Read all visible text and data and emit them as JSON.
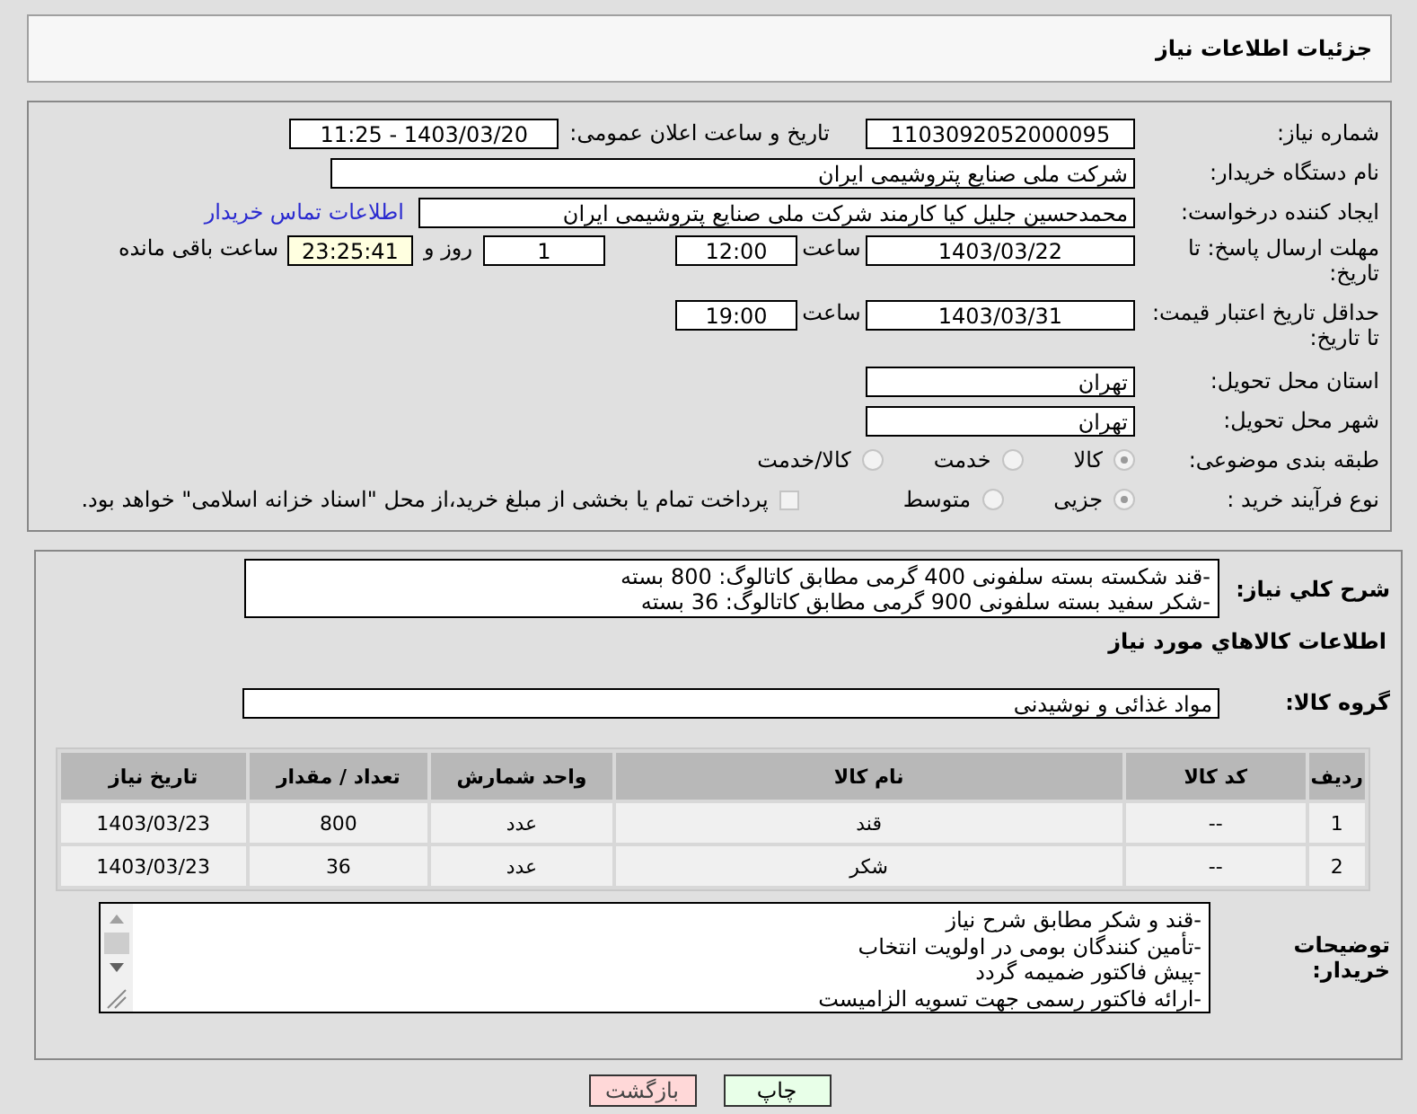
{
  "header": {
    "title": "جزئیات اطلاعات نیاز"
  },
  "need_number": {
    "label": "شماره نیاز:",
    "value": "1103092052000095"
  },
  "announce": {
    "label": "تاریخ و ساعت اعلان عمومی:",
    "value": "1403/03/20 - 11:25"
  },
  "buyer": {
    "label": "نام دستگاه خریدار:",
    "value": "شرکت ملی صنایع پتروشیمی ایران"
  },
  "requester": {
    "label": "ایجاد کننده درخواست:",
    "value": "محمدحسین جلیل کیا کارمند شرکت ملی صنایع پتروشیمی ایران",
    "link": "اطلاعات تماس خریدار"
  },
  "deadline": {
    "label": "مهلت ارسال پاسخ: تا تاریخ:",
    "date": "1403/03/22",
    "time_label": "ساعت",
    "time": "12:00",
    "days": "1",
    "days_label": "روز و",
    "remaining": "23:25:41",
    "remaining_label": "ساعت باقی مانده"
  },
  "validity": {
    "label": "حداقل تاریخ اعتبار قیمت: تا تاریخ:",
    "date": "1403/03/31",
    "time_label": "ساعت",
    "time": "19:00"
  },
  "province": {
    "label": "استان محل تحویل:",
    "value": "تهران"
  },
  "city": {
    "label": "شهر محل تحویل:",
    "value": "تهران"
  },
  "category": {
    "label": "طبقه بندی موضوعی:",
    "options": [
      {
        "label": "کالا",
        "selected": true
      },
      {
        "label": "خدمت",
        "selected": false
      },
      {
        "label": "کالا/خدمت",
        "selected": false
      }
    ]
  },
  "process": {
    "label": "نوع فرآیند خرید :",
    "options": [
      {
        "label": "جزیی",
        "selected": true
      },
      {
        "label": "متوسط",
        "selected": false
      }
    ],
    "treasury": {
      "checked": false,
      "label": "پرداخت تمام یا بخشی از مبلغ خرید،از محل \"اسناد خزانه اسلامی\" خواهد بود."
    }
  },
  "description": {
    "label": "شرح کلي نیاز:",
    "lines": [
      "-قند شکسته بسته سلفونی 400 گرمی مطابق کاتالوگ: 800 بسته",
      "-شکر سفید بسته سلفونی 900 گرمی مطابق کاتالوگ: 36 بسته"
    ]
  },
  "items_heading": "اطلاعات کالاهاي مورد نیاز",
  "goods_group": {
    "label": "گروه کالا:",
    "value": "مواد غذائی و نوشیدنی"
  },
  "table": {
    "columns": [
      "ردیف",
      "کد کالا",
      "نام کالا",
      "واحد شمارش",
      "تعداد / مقدار",
      "تاریخ نیاز"
    ],
    "rows": [
      [
        "1",
        "--",
        "قند",
        "عدد",
        "800",
        "1403/03/23"
      ],
      [
        "2",
        "--",
        "شکر",
        "عدد",
        "36",
        "1403/03/23"
      ]
    ]
  },
  "notes": {
    "label": "توضیحات خریدار:",
    "lines": [
      "-قند و شکر مطابق شرح نیاز",
      "-تأمین کنندگان بومی در اولویت انتخاب",
      "-پیش فاکتور ضمیمه گردد",
      "-ارائه فاکتور رسمی جهت تسویه الزامیست"
    ]
  },
  "buttons": [
    {
      "kind": "print",
      "label": "چاپ"
    },
    {
      "kind": "back",
      "label": "بازگشت"
    }
  ]
}
